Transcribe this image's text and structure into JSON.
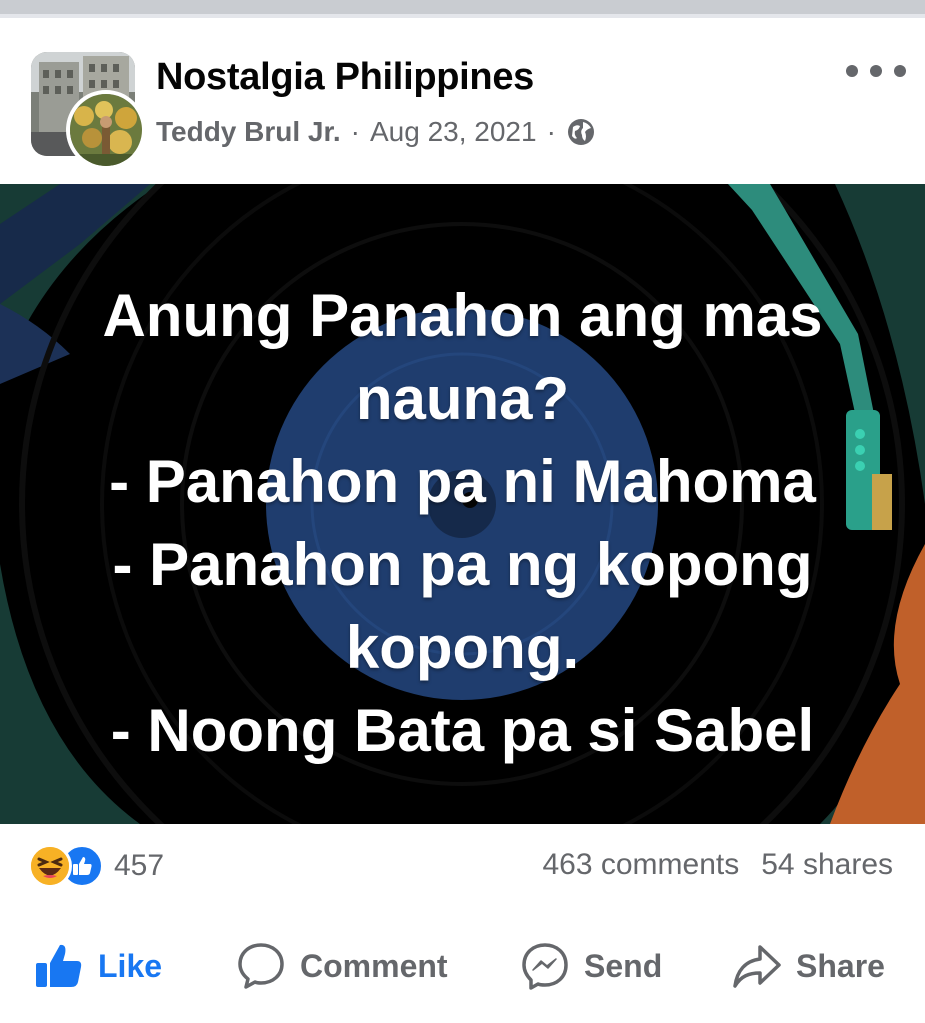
{
  "post": {
    "group_name": "Nostalgia Philippines",
    "author": "Teddy Brul Jr.",
    "separator": "·",
    "date": "Aug 23, 2021",
    "privacy_icon": "globe-icon",
    "more_icon": "more-horizontal-icon"
  },
  "image_text": {
    "lines": [
      "Anung Panahon ang mas",
      "nauna?",
      "- Panahon pa ni Mahoma",
      "- Panahon pa ng kopong",
      "kopong.",
      "- Noong Bata pa si Sabel"
    ]
  },
  "engagement": {
    "reaction_icons": [
      "haha-reaction-icon",
      "like-reaction-icon"
    ],
    "reaction_count": "457",
    "comments": "463 comments",
    "shares": "54 shares"
  },
  "actions": {
    "like": "Like",
    "comment": "Comment",
    "send": "Send",
    "share": "Share"
  },
  "colors": {
    "accent": "#1877f2",
    "secondary_text": "#65676b",
    "primary_text": "#050505",
    "image_background": "#000000",
    "record_label": "#1f3d6e"
  }
}
